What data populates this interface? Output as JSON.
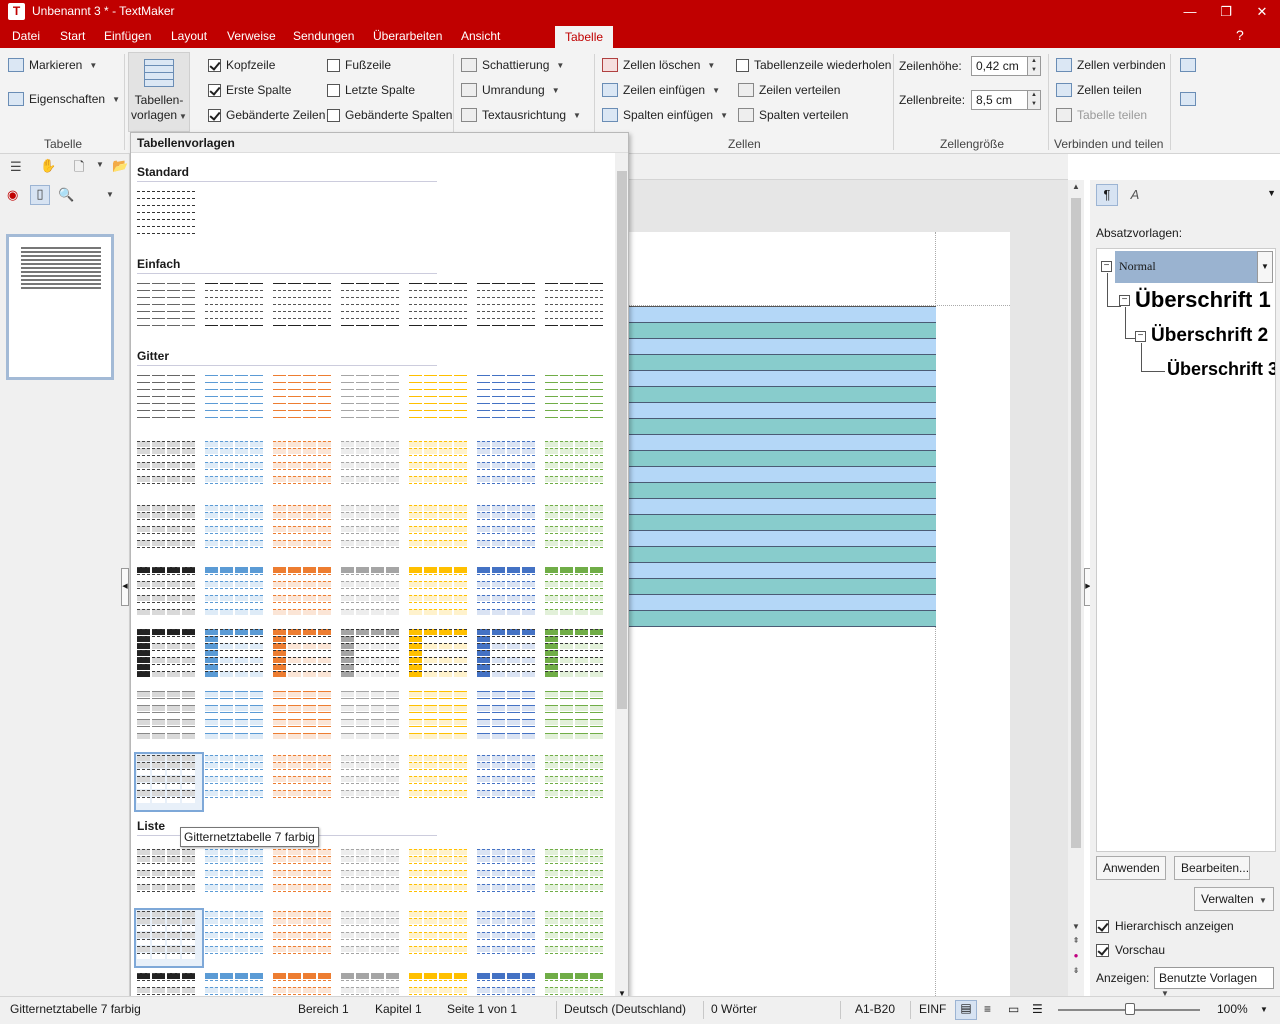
{
  "window": {
    "title": "Unbenannt 3 * - TextMaker",
    "app_icon": "T",
    "buttons": {
      "minimize": "—",
      "restore": "❐",
      "close": "✕"
    }
  },
  "menu": {
    "items": [
      "Datei",
      "Start",
      "Einfügen",
      "Layout",
      "Verweise",
      "Sendungen",
      "Überarbeiten",
      "Ansicht"
    ],
    "active_tab": "Tabelle",
    "help": "?"
  },
  "ribbon": {
    "tabelle_group": {
      "markieren": "Markieren",
      "eigenschaften": "Eigenschaften",
      "label": "Tabelle"
    },
    "vorlagen": {
      "line1": "Tabellen-",
      "line2": "vorlagen"
    },
    "options": {
      "kopfzeile": {
        "label": "Kopfzeile",
        "checked": true
      },
      "erste_spalte": {
        "label": "Erste Spalte",
        "checked": true
      },
      "gebanderte_zeilen": {
        "label": "Gebänderte Zeilen",
        "checked": true
      },
      "fusszeile": {
        "label": "Fußzeile",
        "checked": false
      },
      "letzte_spalte": {
        "label": "Letzte Spalte",
        "checked": false
      },
      "gebanderte_spalten": {
        "label": "Gebänderte Spalten",
        "checked": false
      }
    },
    "format": {
      "schattierung": "Schattierung",
      "umrandung": "Umrandung",
      "textausrichtung": "Textausrichtung"
    },
    "zellen": {
      "zellen_loeschen": "Zellen löschen",
      "zeilen_einfuegen": "Zeilen einfügen",
      "spalten_einfuegen": "Spalten einfügen",
      "tabellenzeile_wiederholen": "Tabellenzeile wiederholen",
      "zeilen_verteilen": "Zeilen verteilen",
      "spalten_verteilen": "Spalten verteilen",
      "label": "Zellen"
    },
    "zellgroesse": {
      "zeilenhoehe_label": "Zeilenhöhe:",
      "zeilenhoehe_value": "0,42 cm",
      "zellenbreite_label": "Zellenbreite:",
      "zellenbreite_value": "8,5 cm",
      "label": "Zellengröße"
    },
    "verbinden": {
      "zellen_verbinden": "Zellen verbinden",
      "zellen_teilen": "Zellen teilen",
      "tabelle_teilen": "Tabelle teilen",
      "label": "Verbinden und teilen"
    }
  },
  "gallery": {
    "header": "Tabellenvorlagen",
    "categories": {
      "standard": "Standard",
      "einfach": "Einfach",
      "gitter": "Gitter",
      "liste": "Liste"
    },
    "tooltip": "Gitternetztabelle 7 farbig",
    "colors": [
      "#222222",
      "#5b9bd5",
      "#ed7d31",
      "#a5a5a5",
      "#ffc000",
      "#4472c4",
      "#70ad47"
    ],
    "light_colors": [
      "#d9d9d9",
      "#deebf7",
      "#fbe5d6",
      "#ededed",
      "#fff2cc",
      "#dae3f3",
      "#e2f0d9"
    ]
  },
  "document": {
    "row_colors": [
      "#b4d7f7",
      "#88cccc"
    ],
    "row_count": 20
  },
  "styles_panel": {
    "label": "Absatzvorlagen:",
    "selected": "Normal",
    "h1": "Überschrift 1",
    "h2": "Überschrift 2",
    "h3": "Überschrift 3",
    "apply": "Anwenden",
    "edit": "Bearbeiten...",
    "manage": "Verwalten",
    "hierarchical": "Hierarchisch anzeigen",
    "preview": "Vorschau",
    "show_label": "Anzeigen:",
    "show_value": "Benutzte Vorlagen"
  },
  "status": {
    "style": "Gitternetztabelle 7 farbig",
    "bereich": "Bereich 1",
    "kapitel": "Kapitel 1",
    "seite": "Seite 1 von 1",
    "sprache": "Deutsch (Deutschland)",
    "woerter": "0 Wörter",
    "zellen": "A1-B20",
    "modus": "EINF",
    "zoom": "100%"
  }
}
